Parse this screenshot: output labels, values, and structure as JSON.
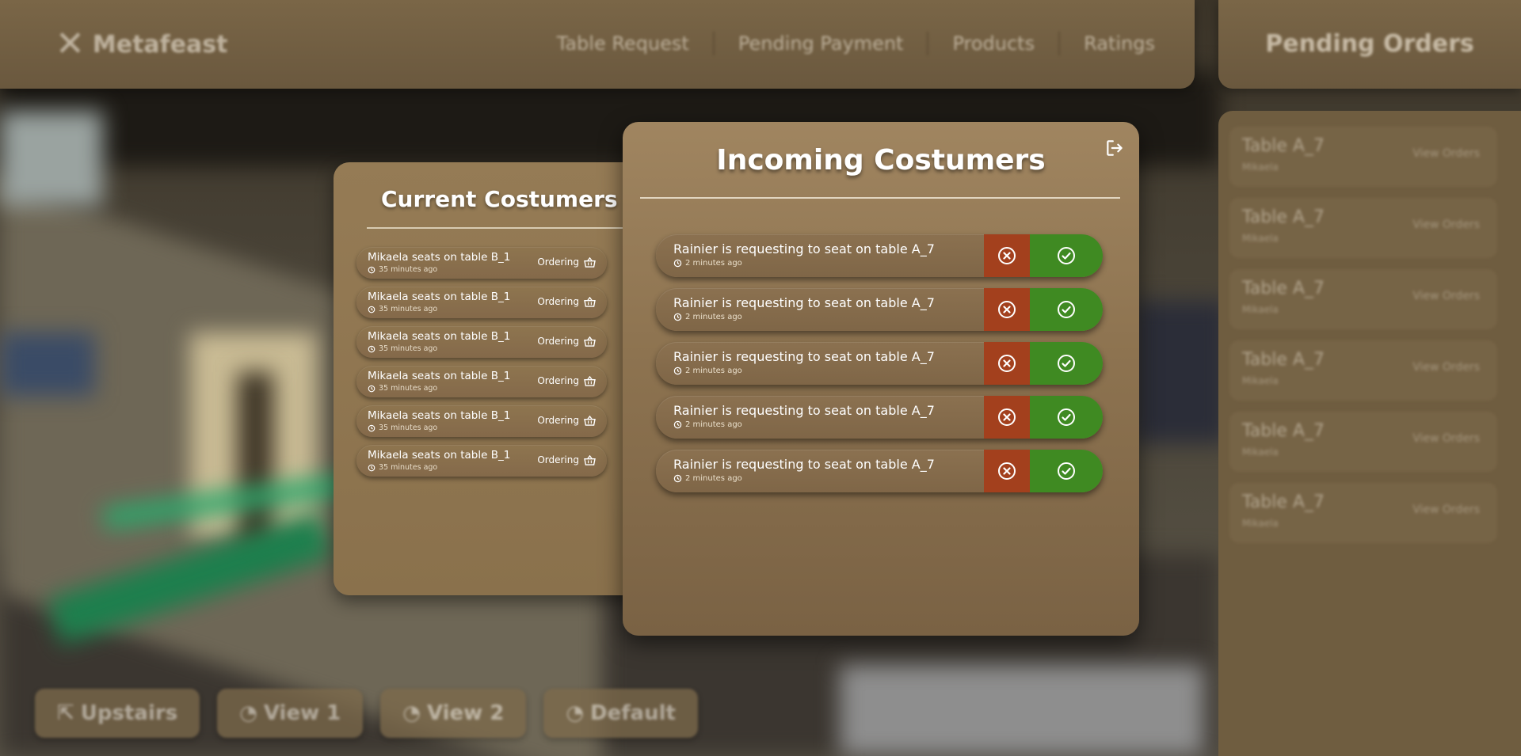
{
  "brand": {
    "name": "Metafeast",
    "icon": "crossed-utensils-icon"
  },
  "topnav": {
    "items": [
      "Table Request",
      "Pending Payment",
      "Products",
      "Ratings"
    ]
  },
  "pending_orders": {
    "title": "Pending Orders",
    "cards": [
      {
        "title": "Table A_7",
        "subtitle": "Mikaela",
        "link": "View Orders"
      },
      {
        "title": "Table A_7",
        "subtitle": "Mikaela",
        "link": "View Orders"
      },
      {
        "title": "Table A_7",
        "subtitle": "Mikaela",
        "link": "View Orders"
      },
      {
        "title": "Table A_7",
        "subtitle": "Mikaela",
        "link": "View Orders"
      },
      {
        "title": "Table A_7",
        "subtitle": "Mikaela",
        "link": "View Orders"
      },
      {
        "title": "Table A_7",
        "subtitle": "Mikaela",
        "link": "View Orders"
      }
    ]
  },
  "view_buttons": [
    "Upstairs",
    "View 1",
    "View 2",
    "Default"
  ],
  "current_customers": {
    "title": "Current Costumers",
    "rows": [
      {
        "text": "Mikaela seats on table B_1",
        "time": "35 minutes ago",
        "status": "Ordering"
      },
      {
        "text": "Mikaela seats on table B_1",
        "time": "35 minutes ago",
        "status": "Ordering"
      },
      {
        "text": "Mikaela seats on table B_1",
        "time": "35 minutes ago",
        "status": "Ordering"
      },
      {
        "text": "Mikaela seats on table B_1",
        "time": "35 minutes ago",
        "status": "Ordering"
      },
      {
        "text": "Mikaela seats on table B_1",
        "time": "35 minutes ago",
        "status": "Ordering"
      },
      {
        "text": "Mikaela seats on table B_1",
        "time": "35 minutes ago",
        "status": "Ordering"
      }
    ]
  },
  "incoming_customers": {
    "title": "Incoming Costumers",
    "rows": [
      {
        "text": "Rainier is requesting to seat on table A_7",
        "time": "2 minutes ago"
      },
      {
        "text": "Rainier is requesting to seat on table A_7",
        "time": "2 minutes ago"
      },
      {
        "text": "Rainier is requesting to seat on table A_7",
        "time": "2 minutes ago"
      },
      {
        "text": "Rainier is requesting to seat on table A_7",
        "time": "2 minutes ago"
      },
      {
        "text": "Rainier is requesting to seat on table A_7",
        "time": "2 minutes ago"
      }
    ]
  },
  "colors": {
    "panel_brown": "#957b55",
    "decline_red": "#a3401d",
    "accept_green": "#3f8a22"
  }
}
